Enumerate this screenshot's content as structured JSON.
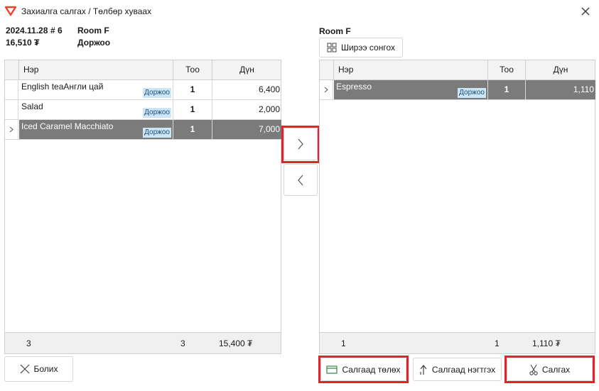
{
  "window": {
    "title": "Захиалга салгах / Төлбөр хуваах"
  },
  "order": {
    "date": "2024.11.28",
    "number": "# 6",
    "total": "16,510 ₮",
    "room": "Room F",
    "waiter": "Доржоо"
  },
  "right_info": {
    "room": "Room F",
    "choose_table_label": "Ширээ сонгох"
  },
  "columns": {
    "name": "Нэр",
    "qty": "Тоо",
    "amount": "Дүн"
  },
  "left_grid": {
    "rows": [
      {
        "name": "English teaАнгли цай",
        "badge": "Доржоо",
        "qty": "1",
        "amount": "6,400",
        "selected": false
      },
      {
        "name": "Salad",
        "badge": "Доржоо",
        "qty": "1",
        "amount": "2,000",
        "selected": false
      },
      {
        "name": "Iced Caramel Macchiato",
        "badge": "Доржоо",
        "qty": "1",
        "amount": "7,000",
        "selected": true
      }
    ],
    "footer": {
      "count": "3",
      "qty": "3",
      "amount": "15,400 ₮"
    }
  },
  "right_grid": {
    "rows": [
      {
        "name": "Espresso",
        "badge": "Доржоо",
        "qty": "1",
        "amount": "1,110",
        "selected": true
      }
    ],
    "footer": {
      "count": "1",
      "qty": "1",
      "amount": "1,110 ₮"
    }
  },
  "buttons": {
    "cancel": "Болих",
    "split_pay": "Салгаад төлөх",
    "split_merge": "Салгаад нэгтгэх",
    "split": "Салгах"
  },
  "icons": {
    "move_right": "chevron-right-icon",
    "move_left": "chevron-left-icon"
  },
  "colors": {
    "highlight": "#e8202a",
    "selected_row": "#7b7b7b",
    "badge_bg": "#cde6f7",
    "logo": "#e8462a"
  }
}
